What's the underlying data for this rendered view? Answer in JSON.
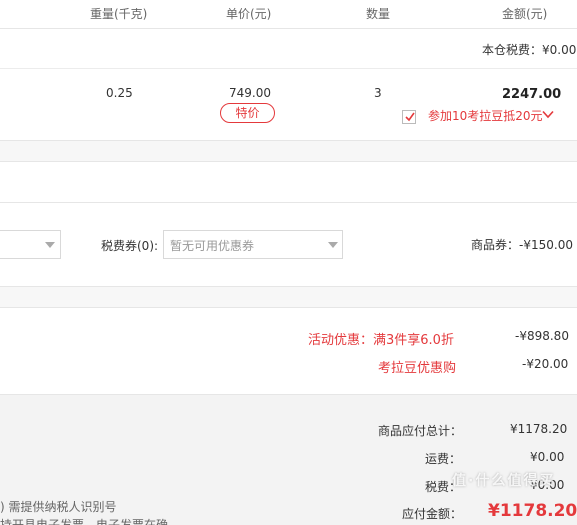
{
  "header": {
    "weight": "重量(千克)",
    "unit_price": "单价(元)",
    "qty": "数量",
    "amount": "金额(元)"
  },
  "warehouse_tax": {
    "label": "本仓税费：",
    "value": "¥0.00"
  },
  "item": {
    "weight": "0.25",
    "price": "749.00",
    "badge": "特价",
    "qty": "3",
    "amount": "2247.00",
    "promo_checked": true,
    "promo_text": "参加10考拉豆抵20元"
  },
  "coupons": {
    "tax_coupon_label": "税费券(0):",
    "tax_coupon_placeholder": "暂无可用优惠券",
    "goods_coupon_label": "商品券：",
    "goods_coupon_value": "-¥150.00"
  },
  "discounts": {
    "activity_label": "活动优惠：满3件享6.0折",
    "activity_value": "-¥898.80",
    "beans_label": "考拉豆优惠购",
    "beans_value": "-¥20.00"
  },
  "summary": {
    "goods_total_label": "商品应付总计：",
    "goods_total_value": "¥1178.20",
    "shipping_label": "运费：",
    "shipping_value": "¥0.00",
    "tax_label": "税费：",
    "tax_value": "¥0.00",
    "payable_label": "应付金额：",
    "payable_value": "¥1178.20"
  },
  "invoice_note": {
    "line1": ") 需提供纳税人识别号",
    "line2": "持开具电子发票，电子发票在确"
  },
  "watermark": "值·什么值得买",
  "colors": {
    "accent_red": "#e4393c",
    "summary_bg": "#f3f3f3"
  }
}
